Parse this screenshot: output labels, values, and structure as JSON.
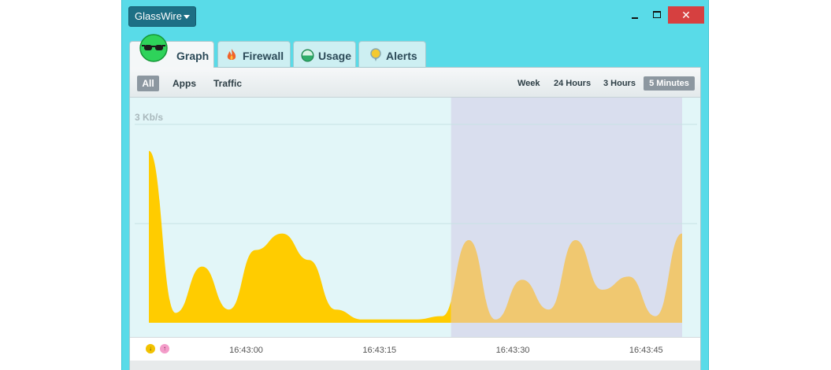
{
  "app": {
    "menu_label": "GlassWire",
    "window_controls": {
      "minimize": "minimize-icon",
      "maximize": "maximize-icon",
      "close": "✕"
    }
  },
  "tabs": [
    {
      "label": "Graph",
      "icon": "graph-glasses-icon",
      "selected": true
    },
    {
      "label": "Firewall",
      "icon": "flame-icon",
      "selected": false
    },
    {
      "label": "Usage",
      "icon": "usage-dial-icon",
      "selected": false
    },
    {
      "label": "Alerts",
      "icon": "alert-pin-icon",
      "selected": false
    }
  ],
  "filters": {
    "all": "All",
    "apps": "Apps",
    "traffic": "Traffic",
    "selected": "All"
  },
  "ranges": {
    "week": "Week",
    "hours24": "24 Hours",
    "hours3": "3 Hours",
    "minutes5": "5 Minutes",
    "selected": "5 Minutes"
  },
  "graph": {
    "scale_label": "3 Kb/s",
    "time_labels": [
      "16:43:00",
      "16:43:15",
      "16:43:30",
      "16:43:45"
    ],
    "legend": {
      "download": "↓",
      "upload": "↑"
    },
    "colors": {
      "download": "#ffcc00",
      "download_faded": "#f0c870",
      "background": "#e2f6f8",
      "highlight": "#d9deee"
    }
  },
  "chart_data": {
    "type": "area",
    "title": "",
    "xlabel": "",
    "ylabel": "",
    "x": [
      "16:42:49",
      "16:42:52",
      "16:42:55",
      "16:42:58",
      "16:43:01",
      "16:43:04",
      "16:43:07",
      "16:43:10",
      "16:43:13",
      "16:43:16",
      "16:43:19",
      "16:43:22",
      "16:43:25",
      "16:43:28",
      "16:43:31",
      "16:43:34",
      "16:43:37",
      "16:43:40",
      "16:43:43",
      "16:43:46",
      "16:43:49"
    ],
    "series": [
      {
        "values": [
          2.6,
          0.15,
          0.85,
          0.2,
          1.1,
          1.35,
          0.95,
          0.2,
          0.05,
          0.05,
          0.05,
          0.1,
          1.25,
          0.05,
          0.65,
          0.2,
          1.25,
          0.5,
          0.7,
          0.1,
          1.35
        ]
      }
    ],
    "ylim": [
      0,
      3
    ],
    "grid": true,
    "highlight_range": [
      "16:43:23",
      "16:43:49"
    ]
  }
}
